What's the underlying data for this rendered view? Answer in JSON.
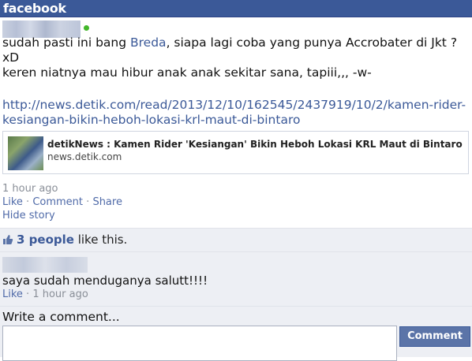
{
  "header": {
    "logo_text": "facebook",
    "background": "#3b5998"
  },
  "post": {
    "text_before_mention": "sudah pasti ini bang ",
    "mention": "Breda",
    "text_after_mention": ", siapa lagi coba yang punya Accrobater di Jkt ? xD",
    "line2": "keren niatnya mau hibur anak anak sekitar sana, tapiii,,, -w-",
    "link": "http://news.detik.com/read/2013/12/10/162545/2437919/10/2/kamen-rider-kesiangan-bikin-heboh-lokasi-krl-maut-di-bintaro",
    "share": {
      "title": "detikNews : Kamen Rider 'Kesiangan' Bikin Heboh Lokasi KRL Maut di Bintaro",
      "domain": "news.detik.com"
    },
    "timestamp": "1 hour ago",
    "actions": {
      "like": "Like",
      "comment": "Comment",
      "share": "Share",
      "separator": " · "
    },
    "hide_story": "Hide story"
  },
  "likes": {
    "count_text": "3 people",
    "suffix": " like this."
  },
  "comment": {
    "text": "saya sudah menduganya salutt!!!!",
    "like": "Like",
    "separator": " · ",
    "timestamp": "1 hour ago"
  },
  "write_comment": {
    "label": "Write a comment...",
    "button": "Comment"
  },
  "colors": {
    "link": "#3b5998",
    "online": "#42b72a",
    "button": "#5b74a8"
  }
}
